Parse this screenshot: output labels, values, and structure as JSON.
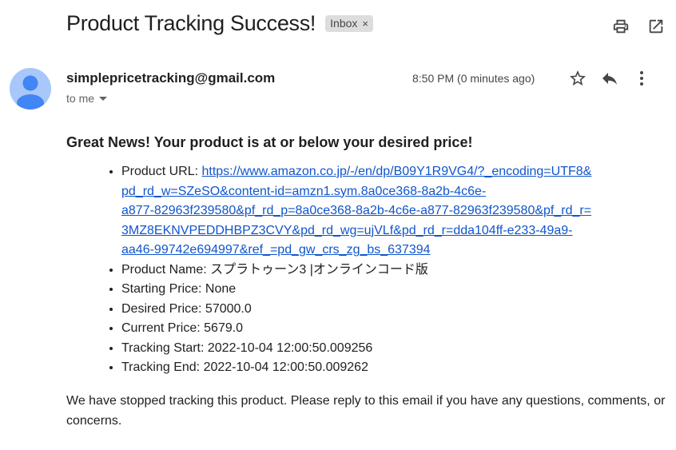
{
  "email": {
    "subject": "Product Tracking Success!",
    "label": "Inbox",
    "label_remove": "×",
    "sender": "simplepricetracking@gmail.com",
    "recipient": "to me",
    "time": "8:50 PM (0 minutes ago)"
  },
  "body": {
    "headline": "Great News! Your product is at or below your desired price!",
    "items": {
      "url_label": "Product URL: ",
      "url_line1": "https://www.amazon.co.jp/-/en/dp/B09Y1R9VG4/?_encoding=UTF8&",
      "url_line2": "pd_rd_w=SZeSO&content-id=amzn1.sym.8a0ce368-8a2b-4c6e-",
      "url_line3": "a877-82963f239580&pf_rd_p=8a0ce368-8a2b-4c6e-a877-82963f239580&pf_rd_r=",
      "url_line4": "3MZ8EKNVPEDDHBPZ3CVY&pd_rd_wg=ujVLf&pd_rd_r=dda104ff-e233-49a9-",
      "url_line5": "aa46-99742e694997&ref_=pd_gw_crs_zg_bs_637394",
      "name": "Product Name: スプラトゥーン3 |オンラインコード版",
      "starting_price": "Starting Price: None",
      "desired_price": "Desired Price: 57000.0",
      "current_price": "Current Price: 5679.0",
      "tracking_start": "Tracking Start: 2022-10-04 12:00:50.009256",
      "tracking_end": "Tracking End: 2022-10-04 12:00:50.009262"
    },
    "closing": "We have stopped tracking this product. Please reply to this email if you have any questions, comments, or concerns."
  },
  "icons": {
    "print": "print-icon",
    "open_new_window": "open-in-new-icon",
    "star": "star-icon",
    "reply": "reply-icon",
    "more": "more-vert-icon",
    "avatar": "avatar-person-icon"
  },
  "colors": {
    "link": "#1155cc",
    "avatar_bg": "#a8c7fa",
    "avatar_fg": "#4285f4",
    "chip_bg": "#dddddd"
  }
}
